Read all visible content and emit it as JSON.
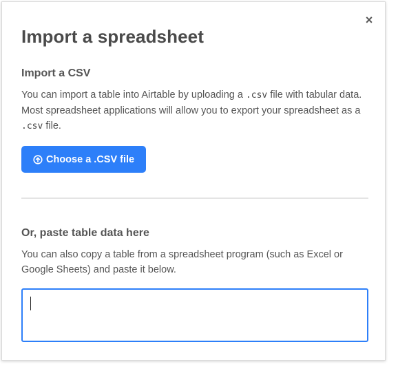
{
  "dialog": {
    "title": "Import a spreadsheet",
    "close_label": "×",
    "csv_section": {
      "heading": "Import a CSV",
      "text_1": "You can import a table into Airtable by uploading a ",
      "code_1": ".csv",
      "text_2": " file with tabular data. Most spreadsheet applications will allow you to export your spreadsheet as a ",
      "code_2": ".csv",
      "text_3": " file.",
      "button_label": "Choose a .CSV file",
      "button_icon": "upload-circle-icon"
    },
    "paste_section": {
      "heading": "Or, paste table data here",
      "description": "You can also copy a table from a spreadsheet program (such as Excel or Google Sheets) and paste it below.",
      "input_value": "",
      "input_placeholder": ""
    },
    "colors": {
      "accent": "#2d7ff9",
      "text": "#555555",
      "title": "#4a4a4a"
    }
  }
}
